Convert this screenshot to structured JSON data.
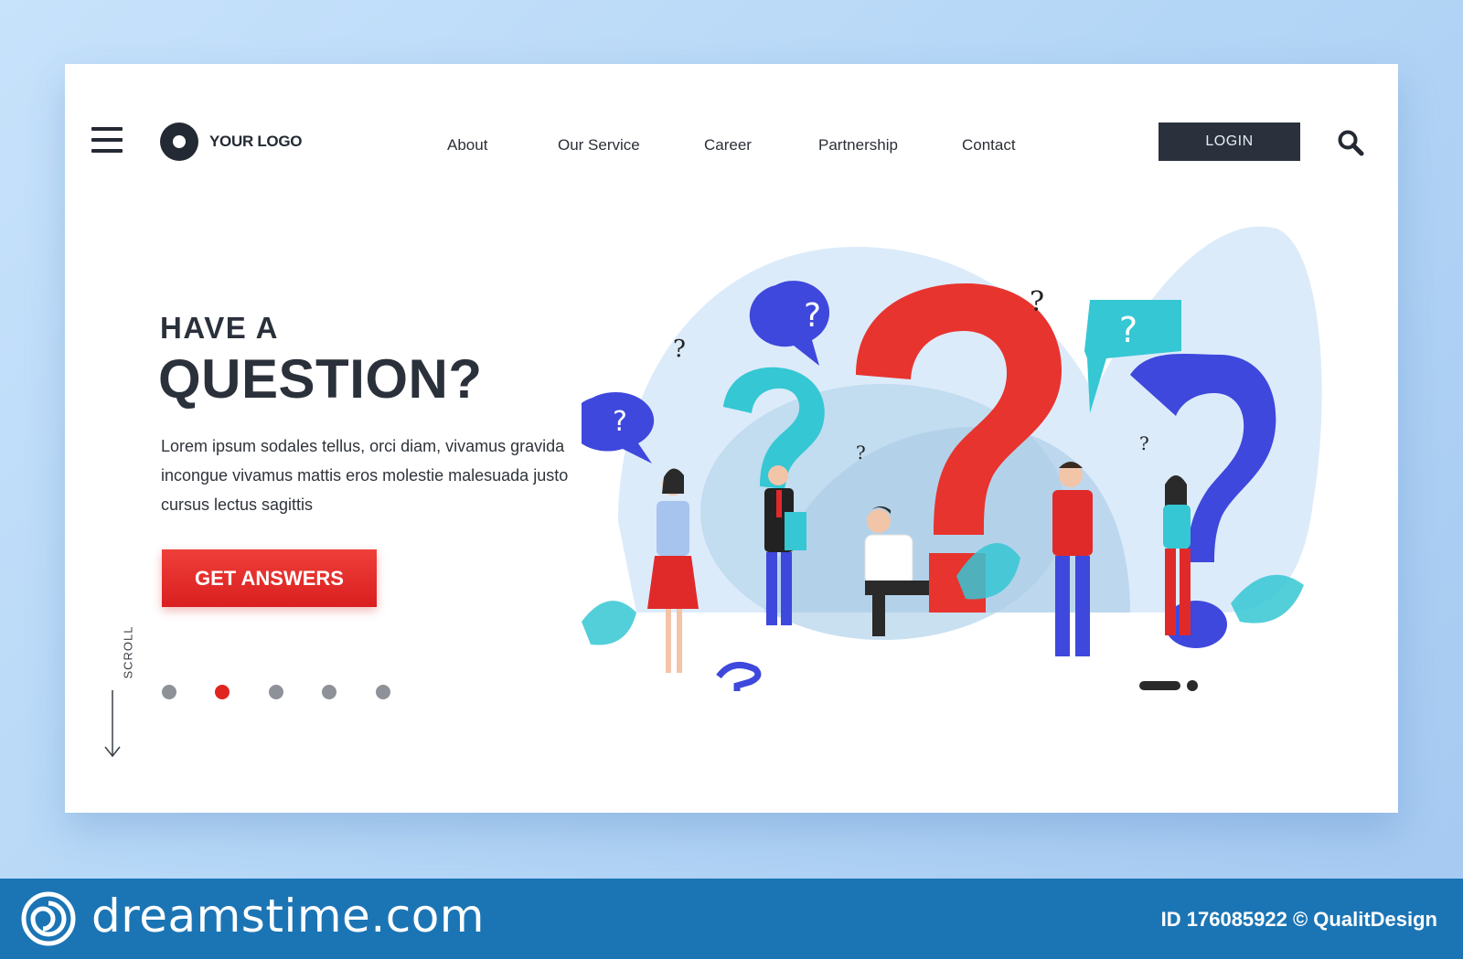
{
  "header": {
    "logo_text": "YOUR LOGO",
    "nav": [
      "About",
      "Our Service",
      "Career",
      "Partnership",
      "Contact"
    ],
    "login_label": "LOGIN"
  },
  "hero": {
    "kicker": "HAVE A",
    "title": "QUESTION?",
    "body": "Lorem ipsum sodales tellus, orci diam, vivamus gravida incongue vivamus mattis eros molestie malesuada justo cursus lectus sagittis",
    "cta_label": "GET ANSWERS"
  },
  "scroll": {
    "label": "SCROLL",
    "pagination_count": 5,
    "active_index": 1
  },
  "footer": {
    "brand": "dreamstime.com",
    "credit": "ID 176085922 © QualitDesign"
  },
  "colors": {
    "accent_red": "#e02420",
    "dark": "#2a313c",
    "footer_blue": "#1b75b5",
    "teal": "#35c7d3",
    "blue": "#3e48dc"
  }
}
